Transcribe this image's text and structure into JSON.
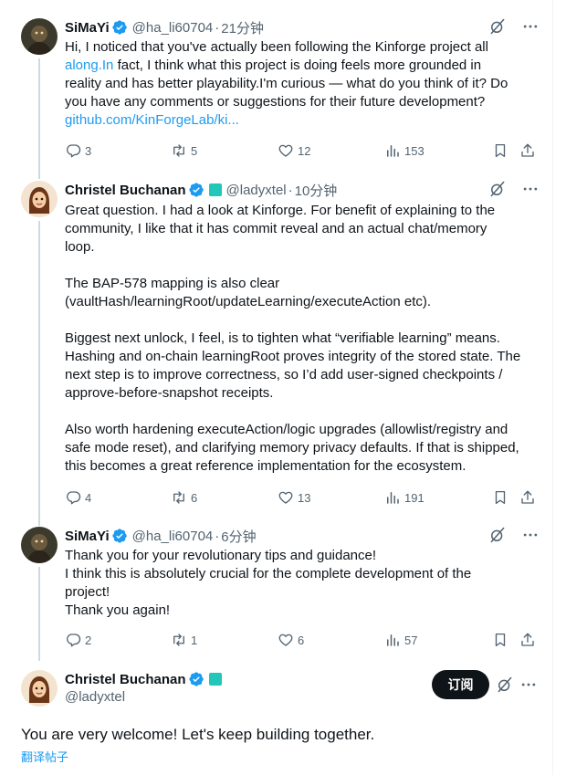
{
  "tweets": [
    {
      "name": "SiMaYi",
      "handle": "@ha_li60704",
      "time": "21分钟",
      "lines": [
        "Hi, I noticed that you've actually been following the Kinforge project all",
        "fact, I think what this project is doing feels more grounded in",
        "reality and has better playability.I'm curious — what do you think of it? Do",
        "you have any comments or suggestions for their future development?"
      ],
      "inline_link": "along.In",
      "link": "github.com/KinForgeLab/ki...",
      "replies": "3",
      "reposts": "5",
      "likes": "12",
      "views": "153"
    },
    {
      "name": "Christel Buchanan",
      "handle": "@ladyxtel",
      "time": "10分钟",
      "paragraphs": [
        [
          "Great question. I had a look at Kinforge. For benefit of explaining to the",
          "community, I like that it has commit reveal and an actual chat/memory",
          "loop."
        ],
        [
          "The BAP-578 mapping is also clear",
          "(vaultHash/learningRoot/updateLearning/executeAction etc)."
        ],
        [
          "Biggest next unlock, I feel, is to tighten what “verifiable learning” means.",
          "Hashing and on-chain learningRoot proves integrity of the stored state. The",
          "next step is to improve correctness, so I’d add user-signed checkpoints /",
          "approve-before-snapshot receipts."
        ],
        [
          "Also worth hardening executeAction/logic upgrades (allowlist/registry and",
          "safe mode reset), and clarifying memory privacy defaults. If that is shipped,",
          "this becomes a great reference implementation for the ecosystem."
        ]
      ],
      "replies": "4",
      "reposts": "6",
      "likes": "13",
      "views": "191"
    },
    {
      "name": "SiMaYi",
      "handle": "@ha_li60704",
      "time": "6分钟",
      "lines": [
        "Thank you for your revolutionary tips and guidance!",
        "I think this is absolutely crucial for the complete development of the",
        "project!",
        "Thank you again!"
      ],
      "replies": "2",
      "reposts": "1",
      "likes": "6",
      "views": "57"
    }
  ],
  "main": {
    "name": "Christel Buchanan",
    "handle": "@ladyxtel",
    "subscribe_label": "订阅",
    "text": "You are very welcome! Let's keep building together.",
    "translate_label": "翻译帖子"
  },
  "sep": "·",
  "colors": {
    "accent": "#1d9bf0",
    "text": "#0f1419",
    "muted": "#536471",
    "thread_line": "#cfd9de",
    "org_badge": "#22c7b8"
  },
  "icons": [
    "grok-icon",
    "more-icon",
    "reply-icon",
    "repost-icon",
    "like-icon",
    "views-icon",
    "bookmark-icon",
    "share-icon",
    "verified-icon"
  ]
}
